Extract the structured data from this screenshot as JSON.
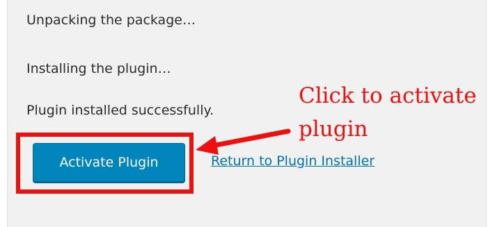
{
  "log": {
    "lines": [
      "Unpacking the package…",
      "Installing the plugin…",
      "Plugin installed successfully."
    ]
  },
  "actions": {
    "activate_label": "Activate Plugin",
    "return_label": "Return to Plugin Installer"
  },
  "annotation": {
    "text": "Click to activate plugin",
    "color": "#ee0f0f"
  },
  "colors": {
    "button": "#0085ba",
    "link": "#0073aa",
    "panel": "#f1f1f1"
  }
}
